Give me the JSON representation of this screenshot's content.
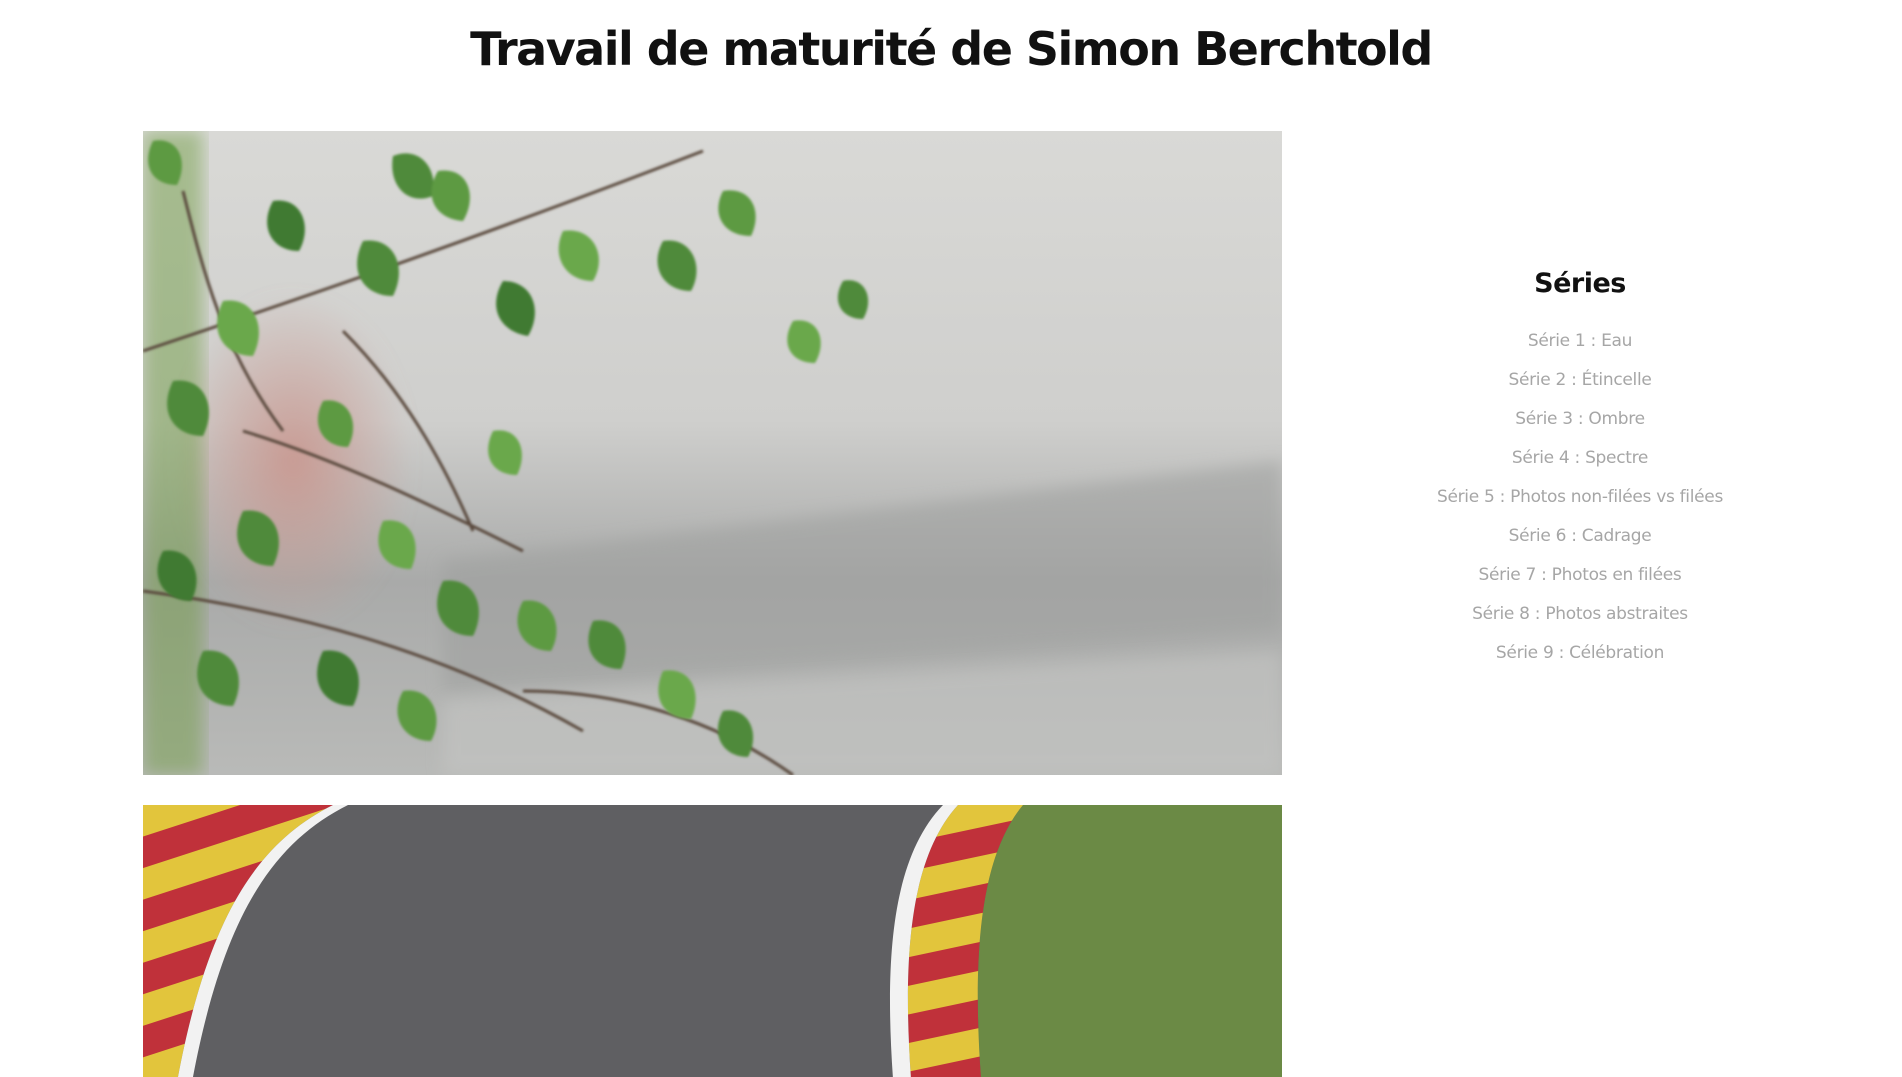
{
  "header": {
    "title": "Travail de maturité de Simon Berchtold"
  },
  "sidebar": {
    "heading": "Séries",
    "items": [
      {
        "label": "Série 1 : Eau"
      },
      {
        "label": "Série 2 : Étincelle"
      },
      {
        "label": "Série 3 : Ombre"
      },
      {
        "label": "Série 4 : Spectre"
      },
      {
        "label": "Série 5 : Photos non-filées vs filées"
      },
      {
        "label": "Série 6 : Cadrage"
      },
      {
        "label": "Série 7 : Photos en filées"
      },
      {
        "label": "Série 8 : Photos abstraites"
      },
      {
        "label": "Série 9 : Célébration"
      }
    ]
  },
  "gallery": {
    "photos": [
      {
        "subject": "birch leaves in front of blurred race track"
      },
      {
        "subject": "race track curve with red and yellow kerbs"
      }
    ]
  },
  "colors": {
    "title": "#111111",
    "link": "#a6a6a6",
    "background": "#ffffff",
    "kerb_red": "#c0313a",
    "kerb_yellow": "#e2c53c",
    "asphalt": "#5f5f62",
    "grass": "#6b8a45"
  }
}
